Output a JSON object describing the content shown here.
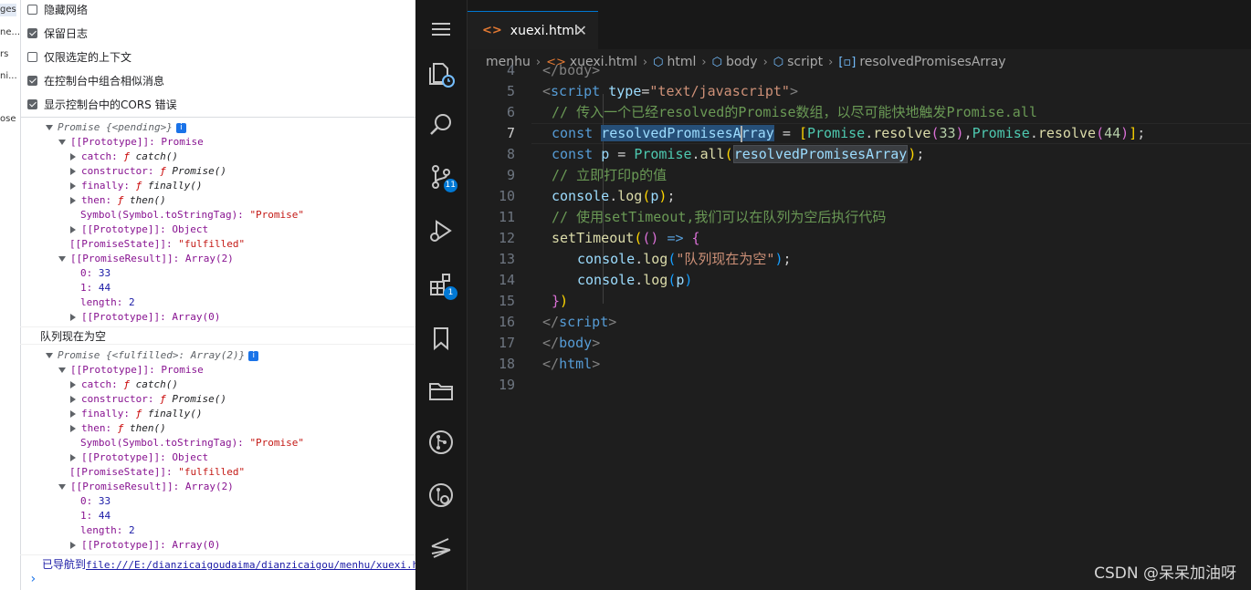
{
  "devtools": {
    "left_strip_fragments": [
      "ges",
      "ne...",
      "rs",
      "ni...",
      "ose"
    ],
    "options": [
      {
        "label": "隐藏网络",
        "checked": false
      },
      {
        "label": "保留日志",
        "checked": true
      },
      {
        "label": "仅限选定的上下文",
        "checked": false
      },
      {
        "label": "在控制台中组合相似消息",
        "checked": true
      },
      {
        "label": "显示控制台中的CORS 错误",
        "checked": true
      }
    ],
    "log1": {
      "header": "Promise {<pending>}",
      "proto": "[[Prototype]]: Promise",
      "catch_key": "catch:",
      "catch_val": "catch()",
      "ctor_key": "constructor:",
      "ctor_val": "Promise()",
      "finally_key": "finally:",
      "finally_val": "finally()",
      "then_key": "then:",
      "then_val": "then()",
      "symbol_key": "Symbol(Symbol.toStringTag):",
      "symbol_val": "\"Promise\"",
      "proto2": "[[Prototype]]: Object",
      "state_key": "[[PromiseState]]:",
      "state_val": "\"fulfilled\"",
      "result": "[[PromiseResult]]: Array(2)",
      "r0_key": "0:",
      "r0_val": "33",
      "r1_key": "1:",
      "r1_val": "44",
      "len_key": "length:",
      "len_val": "2",
      "proto3": "[[Prototype]]: Array(0)"
    },
    "message": "队列现在为空",
    "log2": {
      "header": "Promise {<fulfilled>: Array(2)}",
      "proto": "[[Prototype]]: Promise",
      "catch_key": "catch:",
      "catch_val": "catch()",
      "ctor_key": "constructor:",
      "ctor_val": "Promise()",
      "finally_key": "finally:",
      "finally_val": "finally()",
      "then_key": "then:",
      "then_val": "then()",
      "symbol_key": "Symbol(Symbol.toStringTag):",
      "symbol_val": "\"Promise\"",
      "proto2": "[[Prototype]]: Object",
      "state_key": "[[PromiseState]]:",
      "state_val": "\"fulfilled\"",
      "result": "[[PromiseResult]]: Array(2)",
      "r0_key": "0:",
      "r0_val": "33",
      "r1_key": "1:",
      "r1_val": "44",
      "len_key": "length:",
      "len_val": "2",
      "proto3": "[[Prototype]]: Array(0)"
    },
    "nav_prefix": "已导航到",
    "nav_url": "file:///E:/dianzicaigoudaima/dianzicaigou/menhu/xuexi.html"
  },
  "vscode": {
    "tab_label": "xuexi.html",
    "tab_icon": "<>",
    "breadcrumb": {
      "folder": "menhu",
      "file": "xuexi.html",
      "html": "html",
      "body": "body",
      "script": "script",
      "symbol": "resolvedPromisesArray"
    },
    "badges": {
      "scm": "11",
      "extensions": "1"
    },
    "line_numbers": [
      "4",
      "5",
      "6",
      "7",
      "8",
      "9",
      "10",
      "11",
      "12",
      "13",
      "14",
      "15",
      "16",
      "17",
      "18",
      "19"
    ],
    "code": {
      "l4": "</body>",
      "l5_open": "<",
      "l5_tag": "script",
      "l5_attr": "type",
      "l5_eq": "=",
      "l5_val": "\"text/javascript\"",
      "l5_close": ">",
      "l6": "// 传入一个已经resolved的Promise数组，以尽可能快地触发Promise.all",
      "l7_kw": "const",
      "l7_var_a": "resolvedPromisesA",
      "l7_var_b": "rray",
      "l7_eq": " = ",
      "l7_cls1": "Promise",
      "l7_fn1": "resolve",
      "l7_n1": "33",
      "l7_cls2": "Promise",
      "l7_fn2": "resolve",
      "l7_n2": "44",
      "l8_kw": "const",
      "l8_var": "p",
      "l8_cls": "Promise",
      "l8_fn": "all",
      "l8_arg": "resolvedPromisesArray",
      "l9": "// 立即打印p的值",
      "l10_obj": "console",
      "l10_fn": "log",
      "l10_arg": "p",
      "l11": "// 使用setTimeout,我们可以在队列为空后执行代码",
      "l12_fn": "setTimeout",
      "l12_arrow": "=>",
      "l13_obj": "console",
      "l13_fn": "log",
      "l13_str": "\"队列现在为空\"",
      "l14_obj": "console",
      "l14_fn": "log",
      "l14_arg": "p",
      "l16_tag": "script",
      "l17_tag": "body",
      "l18_tag": "html"
    }
  },
  "watermark": "CSDN @呆呆加油呀"
}
